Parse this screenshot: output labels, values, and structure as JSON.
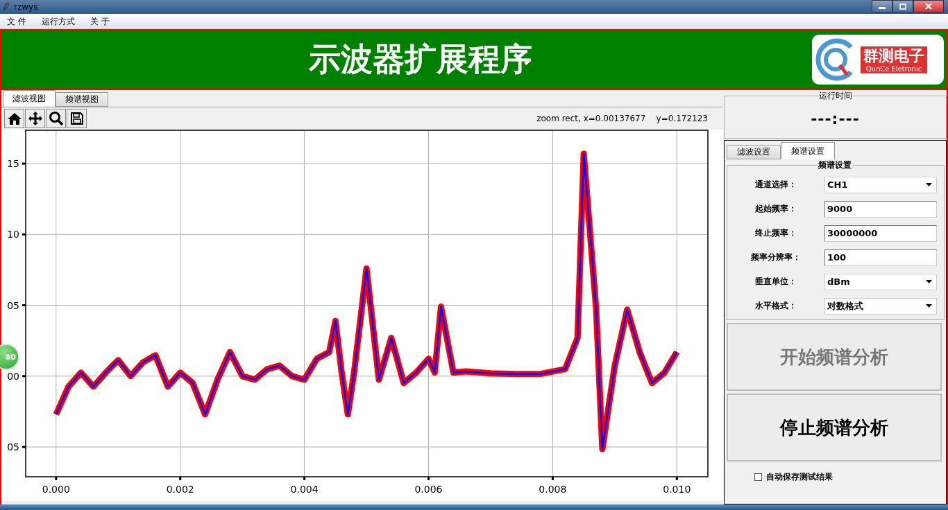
{
  "window": {
    "title": "rzwys"
  },
  "menu": [
    "文 件",
    "运行方式",
    "关 于"
  ],
  "header": {
    "title": "示波器扩展程序",
    "logo_cn": "群测电子",
    "logo_en": "QunCe Eletronic"
  },
  "view_tabs": [
    {
      "label": "滤波视图",
      "selected": true
    },
    {
      "label": "频谱视图",
      "selected": false
    }
  ],
  "plot_toolbar": {
    "status": "zoom rect, x=0.00137677    y=0.172123"
  },
  "chart": {
    "chart_data": {
      "type": "line",
      "grid": true,
      "x": [
        0,
        0.0002,
        0.0004,
        0.0006,
        0.0008,
        0.001,
        0.0012,
        0.0014,
        0.0016,
        0.0018,
        0.002,
        0.0022,
        0.0024,
        0.0026,
        0.0028,
        0.003,
        0.0032,
        0.0034,
        0.0036,
        0.0038,
        0.004,
        0.0042,
        0.0044,
        0.0045,
        0.0046,
        0.0047,
        0.0048,
        0.005,
        0.0052,
        0.0054,
        0.0056,
        0.0058,
        0.006,
        0.0061,
        0.0062,
        0.0064,
        0.0066,
        0.007,
        0.0074,
        0.0078,
        0.0082,
        0.0084,
        0.0085,
        0.0087,
        0.0088,
        0.009,
        0.0092,
        0.0094,
        0.0096,
        0.0098,
        0.01
      ],
      "series": [
        {
          "color": "#ff0000",
          "values": [
            -2.7,
            -0.74,
            0.25,
            -0.74,
            0.25,
            1.13,
            0,
            0.98,
            1.47,
            -0.74,
            0.25,
            -0.49,
            -2.7,
            -0.25,
            1.7,
            0,
            -0.25,
            0.49,
            0.74,
            0,
            -0.25,
            1.23,
            1.7,
            3.9,
            0.25,
            -2.7,
            0.25,
            7.6,
            -0.25,
            2.7,
            -0.49,
            0.25,
            1.23,
            0.25,
            4.9,
            0.25,
            0.34,
            0.2,
            0.15,
            0.15,
            0.5,
            2.7,
            15.7,
            4.7,
            -5.15,
            0.74,
            4.7,
            1.7,
            -0.49,
            0.25,
            1.7
          ]
        },
        {
          "color": "#0000ff",
          "values": [
            -2.7,
            -0.74,
            0.25,
            -0.74,
            0.25,
            1.13,
            0,
            0.98,
            1.47,
            -0.74,
            0.25,
            -0.49,
            -2.7,
            -0.25,
            1.7,
            0,
            -0.25,
            0.49,
            0.74,
            0,
            -0.25,
            1.23,
            1.7,
            3.9,
            0.25,
            -2.7,
            0.25,
            7.6,
            -0.25,
            2.7,
            -0.49,
            0.25,
            1.23,
            0.25,
            4.9,
            0.25,
            0.34,
            0.2,
            0.15,
            0.15,
            0.5,
            2.7,
            15.7,
            4.7,
            -5.15,
            0.74,
            4.7,
            1.7,
            -0.49,
            0.25,
            1.7
          ]
        }
      ],
      "xlim": [
        -0.00049,
        0.0105
      ],
      "ylim": [
        -7.1,
        17.35
      ],
      "xticks": [
        {
          "value": 0,
          "label": "0.000"
        },
        {
          "value": 0.002,
          "label": "0.002"
        },
        {
          "value": 0.004,
          "label": "0.004"
        },
        {
          "value": 0.006,
          "label": "0.006"
        },
        {
          "value": 0.008,
          "label": "0.008"
        },
        {
          "value": 0.01,
          "label": "0.010"
        }
      ],
      "yticks": [
        {
          "value": 15,
          "label": "15"
        },
        {
          "value": 10,
          "label": "10"
        },
        {
          "value": 5,
          "label": "05"
        },
        {
          "value": 0,
          "label": "00"
        },
        {
          "value": -5,
          "label": "05"
        }
      ]
    }
  },
  "floating_badge": {
    "text": "80"
  },
  "run_time": {
    "title": "运行时间",
    "value": "---:---"
  },
  "settings_tabs": [
    {
      "label": "滤波设置",
      "selected": false
    },
    {
      "label": "频谱设置",
      "selected": true
    }
  ],
  "spectrum_settings": {
    "title": "频谱设置",
    "fields": [
      {
        "kind": "select",
        "label": "通道选择：",
        "value": "CH1"
      },
      {
        "kind": "input",
        "label": "起始频率：",
        "value": "9000"
      },
      {
        "kind": "input",
        "label": "终止频率：",
        "value": "30000000"
      },
      {
        "kind": "input",
        "label": "频率分辨率：",
        "value": "100"
      },
      {
        "kind": "select",
        "label": "垂直单位：",
        "value": "dBm"
      },
      {
        "kind": "select",
        "label": "水平格式：",
        "value": "对数格式"
      }
    ]
  },
  "actions": [
    {
      "label": "开始频谱分析",
      "disabled": true
    },
    {
      "label": "停止频谱分析",
      "disabled": false
    }
  ],
  "auto_save": {
    "label": "自动保存测试结果",
    "checked": false
  }
}
